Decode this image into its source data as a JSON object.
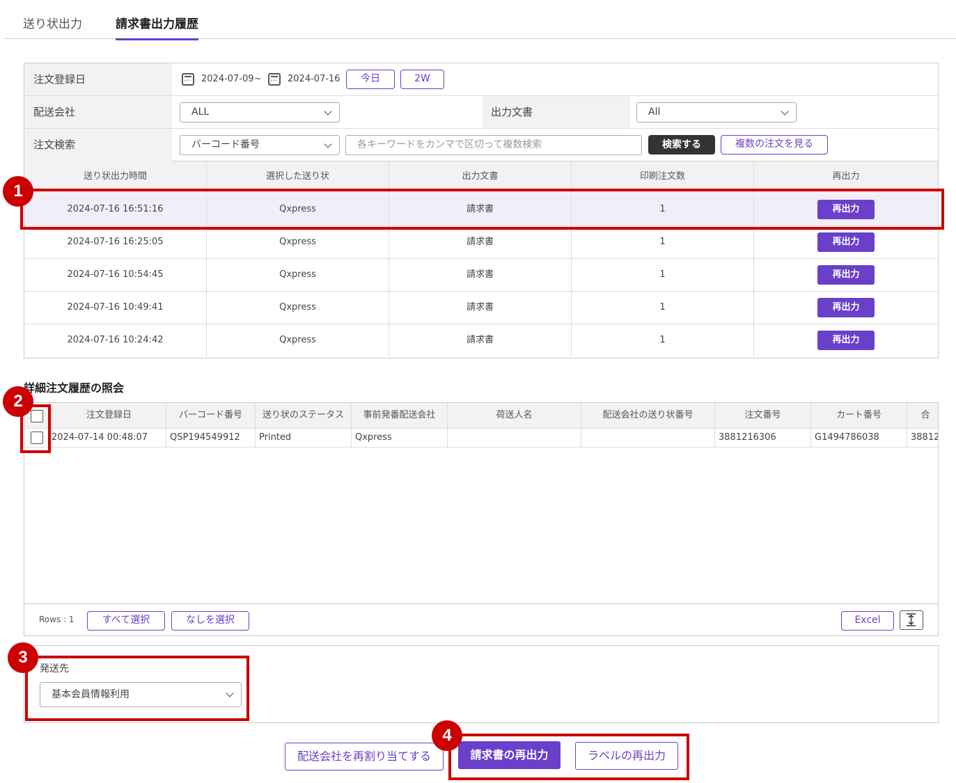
{
  "tabs": [
    {
      "label": "送り状出力",
      "active": false
    },
    {
      "label": "請求書出力履歴",
      "active": true
    }
  ],
  "filter": {
    "order_date_label": "注文登録日",
    "date_from": "2024-07-09",
    "date_sep": "~",
    "date_to": "2024-07-16",
    "today_button": "今日",
    "two_week_button": "2W",
    "carrier_label": "配送会社",
    "carrier_value": "ALL",
    "doc_label": "出力文書",
    "doc_value": "All",
    "search_label": "注文検索",
    "search_type_value": "バーコード番号",
    "search_placeholder": "各キーワードをカンマで区切って複数検索",
    "search_button": "検索する",
    "multi_button": "複数の注文を見る"
  },
  "results": {
    "headers": [
      "送り状出力時間",
      "選択した送り状",
      "出力文書",
      "印刷注文数",
      "再出力"
    ],
    "rows": [
      {
        "time": "2024-07-16 16:51:16",
        "waybill": "Qxpress",
        "doc": "請求書",
        "count": "1",
        "action": "再出力"
      },
      {
        "time": "2024-07-16 16:25:05",
        "waybill": "Qxpress",
        "doc": "請求書",
        "count": "1",
        "action": "再出力"
      },
      {
        "time": "2024-07-16 10:54:45",
        "waybill": "Qxpress",
        "doc": "請求書",
        "count": "1",
        "action": "再出力"
      },
      {
        "time": "2024-07-16 10:49:41",
        "waybill": "Qxpress",
        "doc": "請求書",
        "count": "1",
        "action": "再出力"
      },
      {
        "time": "2024-07-16 10:24:42",
        "waybill": "Qxpress",
        "doc": "請求書",
        "count": "1",
        "action": "再出力"
      }
    ]
  },
  "detail": {
    "title": "詳細注文履歴の照会",
    "headers": [
      "注文登録日",
      "バーコード番号",
      "送り状のステータス",
      "事前発番配送会社",
      "荷送人名",
      "配送会社の送り状番号",
      "注文番号",
      "カート番号",
      "合"
    ],
    "rows": [
      {
        "date": "2024-07-14 00:48:07",
        "barcode": "QSP194549912",
        "status": "Printed",
        "carrier": "Qxpress",
        "shipper": "",
        "tracking": "",
        "order_no": "3881216306",
        "cart_no": "G1494786038",
        "extra": "38812"
      }
    ],
    "rows_label": "Rows : 1",
    "select_all": "すべて選択",
    "select_none": "なしを選択",
    "excel": "Excel"
  },
  "send_to": {
    "label": "発送先",
    "value": "基本会員情報利用"
  },
  "bottom": {
    "reassign": "配送会社を再割り当てする",
    "reprint_invoice": "請求書の再出力",
    "reprint_label": "ラベルの再出力"
  },
  "callouts": [
    "1",
    "2",
    "3",
    "4"
  ],
  "colors": {
    "accent": "#6a3fc9",
    "callout": "#cc0000",
    "dark_button": "#333333"
  }
}
